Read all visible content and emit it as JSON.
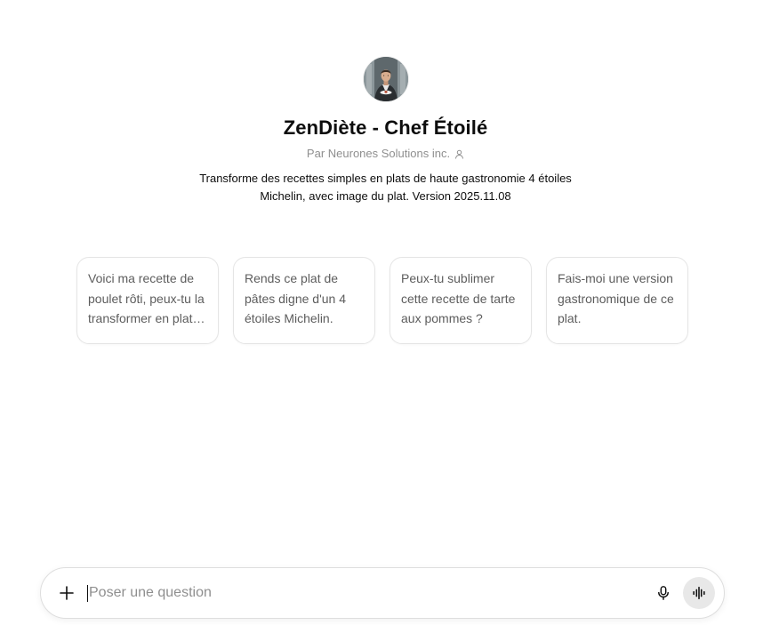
{
  "gpt": {
    "name": "ZenDiète - Chef Étoilé",
    "byline": "Par Neurones Solutions inc.",
    "description": "Transforme des recettes simples en plats de haute gastronomie 4 étoiles Michelin, avec image du plat. Version 2025.11.08",
    "avatar_icon": "chef-portrait-avatar"
  },
  "starters": [
    {
      "text": "Voici ma recette de poulet rôti, peux-tu la transformer en plat gastronomique ?"
    },
    {
      "text": "Rends ce plat de pâtes digne d'un 4 étoiles Michelin."
    },
    {
      "text": "Peux-tu sublimer cette recette de tarte aux pommes ?"
    },
    {
      "text": "Fais-moi une version gastronomique de ce plat."
    }
  ],
  "composer": {
    "placeholder": "Poser une question",
    "value": "",
    "icons": {
      "attach": "plus-icon",
      "dictate": "microphone-icon",
      "voice": "voice-mode-icon"
    }
  },
  "colors": {
    "text_primary": "#0d0d0d",
    "text_secondary": "#8f8f8f",
    "card_border": "#e5e5e5",
    "voice_button_bg": "#e8e8e8"
  }
}
